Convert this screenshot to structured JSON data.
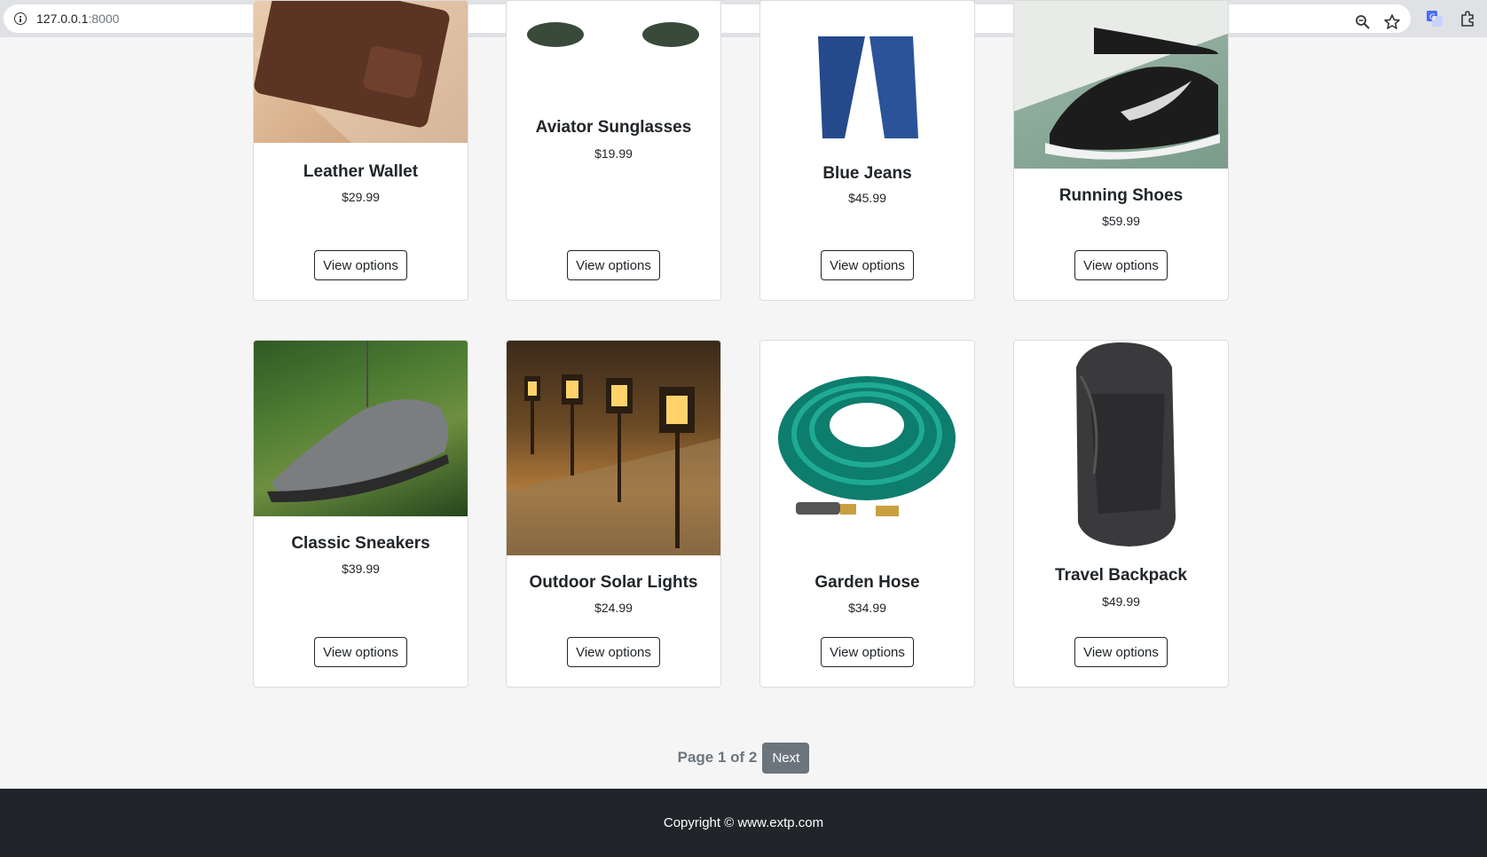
{
  "browser": {
    "url_host": "127.0.0.1",
    "url_port": ":8000",
    "icons": [
      "info-icon",
      "zoom-icon",
      "bookmark-star-icon",
      "translate-icon",
      "extensions-icon"
    ]
  },
  "products": [
    {
      "name": "Leather Wallet",
      "price": "$29.99",
      "button": "View options",
      "image": "leather-wallet-image"
    },
    {
      "name": "Aviator Sunglasses",
      "price": "$19.99",
      "button": "View options",
      "image": "aviator-sunglasses-image"
    },
    {
      "name": "Blue Jeans",
      "price": "$45.99",
      "button": "View options",
      "image": "blue-jeans-image"
    },
    {
      "name": "Running Shoes",
      "price": "$59.99",
      "button": "View options",
      "image": "running-shoes-image"
    },
    {
      "name": "Classic Sneakers",
      "price": "$39.99",
      "button": "View options",
      "image": "classic-sneakers-image"
    },
    {
      "name": "Outdoor Solar Lights",
      "price": "$24.99",
      "button": "View options",
      "image": "solar-lights-image"
    },
    {
      "name": "Garden Hose",
      "price": "$34.99",
      "button": "View options",
      "image": "garden-hose-image"
    },
    {
      "name": "Travel Backpack",
      "price": "$49.99",
      "button": "View options",
      "image": "travel-backpack-image"
    }
  ],
  "pagination": {
    "page_text": "Page 1 of 2",
    "next_label": "Next"
  },
  "footer": {
    "copyright": "Copyright © www.extp.com"
  },
  "colors": {
    "footer_bg": "#212529",
    "next_button_bg": "#6c757d",
    "page_bg": "#f5f5f5"
  }
}
